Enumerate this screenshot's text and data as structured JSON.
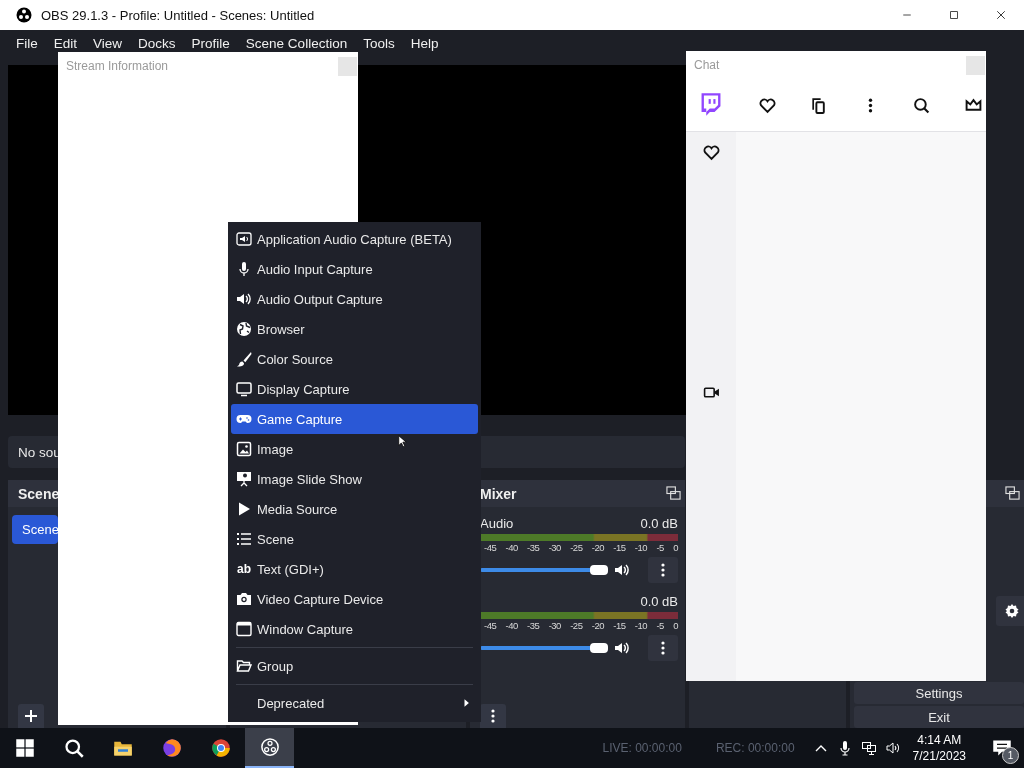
{
  "window": {
    "title": "OBS 29.1.3 - Profile: Untitled - Scenes: Untitled"
  },
  "menu_bar": [
    "File",
    "Edit",
    "View",
    "Docks",
    "Profile",
    "Scene Collection",
    "Tools",
    "Help"
  ],
  "sources_bar": {
    "text": "No sou"
  },
  "scenes": {
    "title": "Scene",
    "items": [
      {
        "label": "Scene",
        "selected": true
      }
    ]
  },
  "mixer": {
    "title": "Mixer",
    "channels": [
      {
        "name": "Audio",
        "reading": "0.0 dB",
        "level": 1,
        "scale": [
          "-45",
          "-40",
          "-35",
          "-30",
          "-25",
          "-20",
          "-15",
          "-10",
          "-5",
          "0"
        ]
      },
      {
        "reading": "0.0 dB",
        "level": 1,
        "scale": [
          "-45",
          "-40",
          "-35",
          "-30",
          "-25",
          "-20",
          "-15",
          "-10",
          "-5",
          "0"
        ]
      }
    ]
  },
  "controls": {
    "buttons": [
      "Settings",
      "Exit"
    ]
  },
  "stream_info": {
    "title": "Stream Information"
  },
  "chat": {
    "title": "Chat"
  },
  "context_menu": {
    "sections": [
      {
        "items": [
          {
            "label": "Application Audio Capture (BETA)",
            "kind": "entry",
            "selected": false
          },
          {
            "label": "Audio Input Capture",
            "kind": "entry",
            "selected": false
          },
          {
            "label": "Audio Output Capture",
            "kind": "entry",
            "selected": false
          },
          {
            "label": "Browser",
            "kind": "entry",
            "selected": false
          },
          {
            "label": "Color Source",
            "kind": "entry",
            "selected": false
          },
          {
            "label": "Display Capture",
            "kind": "entry",
            "selected": false
          },
          {
            "label": "Game Capture",
            "kind": "entry",
            "selected": true
          },
          {
            "label": "Image",
            "kind": "entry",
            "selected": false
          },
          {
            "label": "Image Slide Show",
            "kind": "entry",
            "selected": false
          },
          {
            "label": "Media Source",
            "kind": "entry",
            "selected": false
          },
          {
            "label": "Scene",
            "kind": "entry",
            "selected": false
          },
          {
            "label": "Text (GDI+)",
            "kind": "entry",
            "selected": false,
            "glyph": "ab"
          },
          {
            "label": "Video Capture Device",
            "kind": "entry",
            "selected": false
          },
          {
            "label": "Window Capture",
            "kind": "entry",
            "selected": false
          }
        ]
      },
      {
        "items": [
          {
            "label": "Group",
            "kind": "entry",
            "selected": false
          }
        ]
      },
      {
        "items": [
          {
            "label": "Deprecated",
            "kind": "submenu",
            "selected": false
          }
        ]
      }
    ]
  },
  "status_bar": {
    "live": "LIVE: 00:00:00",
    "rec": "REC: 00:00:00"
  },
  "taskbar": {
    "apps": [
      {
        "selected": false
      },
      {
        "selected": false
      },
      {
        "selected": false
      },
      {
        "selected": true
      }
    ],
    "time": "4:14 AM",
    "date": "7/21/2023",
    "notification_count": "1"
  }
}
